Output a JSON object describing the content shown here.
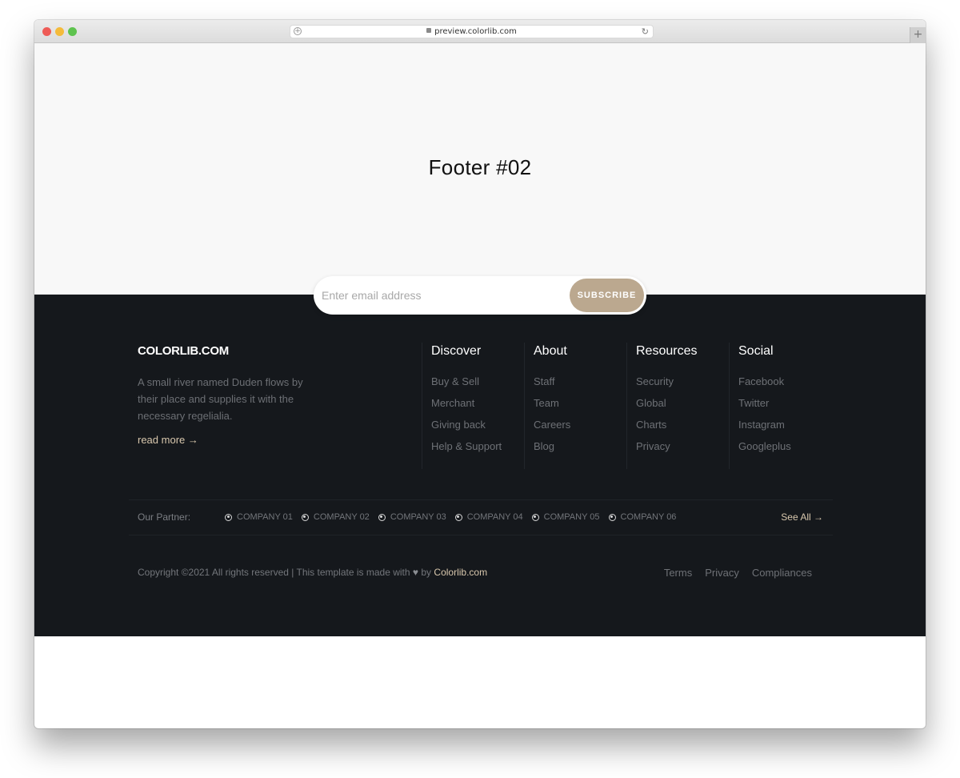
{
  "browser": {
    "url": "preview.colorlib.com",
    "new_tab": "+"
  },
  "hero": {
    "title": "Footer #02"
  },
  "subscribe": {
    "placeholder": "Enter email address",
    "value": "",
    "button_label": "SUBSCRIBE"
  },
  "footer": {
    "brand": "COLORLIB.COM",
    "description": "A small river named Duden flows by their place and supplies it with the necessary regelialia.",
    "read_more": "read more →",
    "columns": [
      {
        "title": "Discover",
        "links": [
          "Buy & Sell",
          "Merchant",
          "Giving back",
          "Help & Support"
        ]
      },
      {
        "title": "About",
        "links": [
          "Staff",
          "Team",
          "Careers",
          "Blog"
        ]
      },
      {
        "title": "Resources",
        "links": [
          "Security",
          "Global",
          "Charts",
          "Privacy"
        ]
      },
      {
        "title": "Social",
        "links": [
          "Facebook",
          "Twitter",
          "Instagram",
          "Googleplus"
        ]
      }
    ],
    "partners": {
      "label": "Our Partner:",
      "items": [
        "COMPANY 01",
        "COMPANY 02",
        "COMPANY 03",
        "COMPANY 04",
        "COMPANY 05",
        "COMPANY 06"
      ],
      "see_all": "See All →"
    },
    "copyright": {
      "text": "Copyright ©2021 All rights reserved | This template is made with",
      "heart": "♥",
      "by": "by",
      "link": "Colorlib.com"
    },
    "legal_links": [
      "Terms",
      "Privacy",
      "Compliances"
    ]
  },
  "colors": {
    "accent": "#bba88f",
    "link_accent": "#d8c7ad",
    "footer_bg": "#15181c",
    "hero_bg": "#f8f8f8"
  }
}
